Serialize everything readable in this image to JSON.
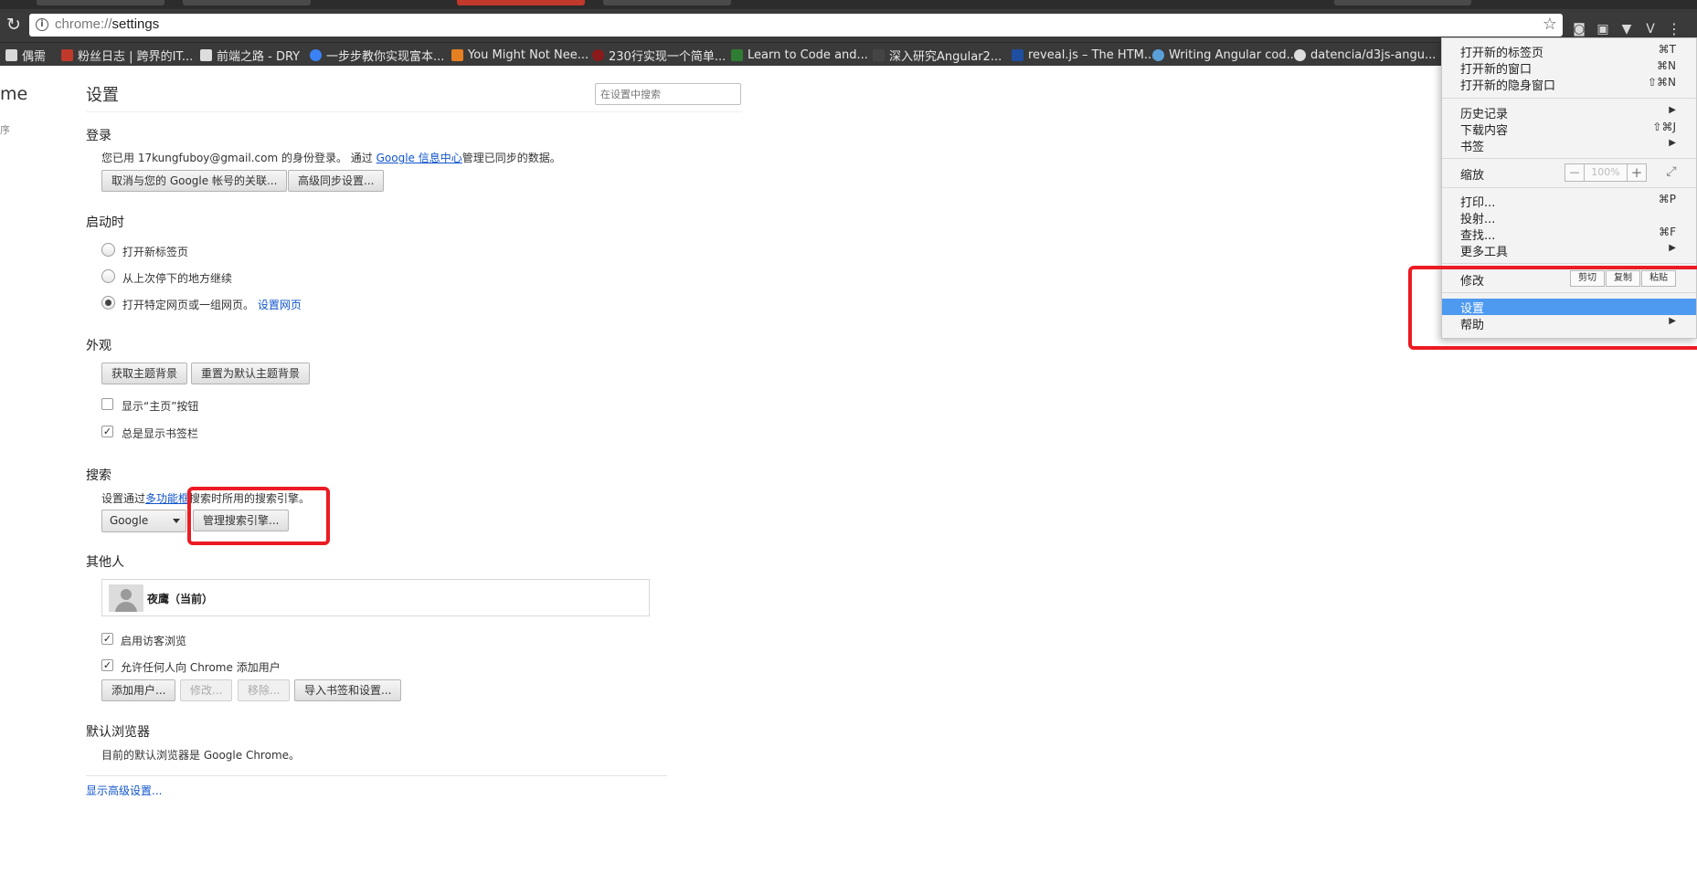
{
  "browser": {
    "url_scheme": "chrome://",
    "url_path": "settings"
  },
  "bookmarks": [
    {
      "label": "偶需",
      "icon": "folder-icon",
      "color": "#d9d9d9"
    },
    {
      "label": "粉丝日志 | 跨界的IT...",
      "icon": "site-icon",
      "color": "#c0392b"
    },
    {
      "label": "前端之路 - DRY",
      "icon": "image-icon",
      "color": "#dddddd"
    },
    {
      "label": "一步步教你实现富本...",
      "icon": "site-icon",
      "color": "#3b82f6"
    },
    {
      "label": "You Might Not Nee...",
      "icon": "site-icon",
      "color": "#e67e22"
    },
    {
      "label": "230行实现一个简单...",
      "icon": "site-icon",
      "color": "#8b1a1a"
    },
    {
      "label": "Learn to Code and...",
      "icon": "site-icon",
      "color": "#2e7d32"
    },
    {
      "label": "深入研究Angular2...",
      "icon": "site-icon",
      "color": "#444444"
    },
    {
      "label": "reveal.js – The HTM...",
      "icon": "site-icon",
      "color": "#1e4fa0"
    },
    {
      "label": "Writing Angular cod...",
      "icon": "cloud-icon",
      "color": "#5aa0d8"
    },
    {
      "label": "datencia/d3js-angu...",
      "icon": "github-icon",
      "color": "#dddddd"
    }
  ],
  "nav": {
    "app_partial": "me",
    "sub_partial": "序"
  },
  "settings": {
    "title": "设置",
    "search_placeholder": "在设置中搜索",
    "signin": {
      "heading": "登录",
      "text_prefix": "您已用 17kungfuboy@gmail.com 的身份登录。 通过 ",
      "link": "Google 信息中心",
      "text_suffix": "管理已同步的数据。",
      "disconnect_button": "取消与您的 Google 帐号的关联...",
      "advanced_sync_button": "高级同步设置..."
    },
    "startup": {
      "heading": "启动时",
      "options": [
        "打开新标签页",
        "从上次停下的地方继续",
        "打开特定网页或一组网页。"
      ],
      "selected_index": 2,
      "set_pages_link": "设置网页"
    },
    "appearance": {
      "heading": "外观",
      "get_themes_button": "获取主题背景",
      "reset_theme_button": "重置为默认主题背景",
      "show_home_label": "显示“主页”按钮",
      "show_home_checked": false,
      "show_bookmarks_label": "总是显示书签栏",
      "show_bookmarks_checked": true
    },
    "search": {
      "heading": "搜索",
      "text_prefix": "设置通过",
      "link": "多功能框",
      "text_suffix": "搜索时所用的搜索引擎。",
      "engine": "Google",
      "manage_button": "管理搜索引擎..."
    },
    "people": {
      "heading": "其他人",
      "profile_name": "夜鹰（当前）",
      "guest_label": "启用访客浏览",
      "guest_checked": true,
      "allow_add_label": "允许任何人向 Chrome 添加用户",
      "allow_add_checked": true,
      "add_user_button": "添加用户...",
      "edit_button": "修改...",
      "remove_button": "移除...",
      "import_button": "导入书签和设置..."
    },
    "default_browser": {
      "heading": "默认浏览器",
      "text": "目前的默认浏览器是 Google Chrome。"
    },
    "show_advanced_link": "显示高级设置..."
  },
  "menu": {
    "new_tab": "打开新的标签页",
    "new_tab_sc": "⌘T",
    "new_window": "打开新的窗口",
    "new_window_sc": "⌘N",
    "incognito": "打开新的隐身窗口",
    "incognito_sc": "⇧⌘N",
    "history": "历史记录",
    "downloads": "下载内容",
    "downloads_sc": "⇧⌘J",
    "bookmarks": "书签",
    "zoom": "缩放",
    "zoom_minus": "—",
    "zoom_value": "100%",
    "zoom_plus": "+",
    "print": "打印...",
    "print_sc": "⌘P",
    "cast": "投射...",
    "find": "查找...",
    "find_sc": "⌘F",
    "more_tools": "更多工具",
    "edit": "修改",
    "cut": "剪切",
    "copy": "复制",
    "paste": "粘贴",
    "settings": "设置",
    "help": "帮助"
  },
  "colors": {
    "link": "#1155cc",
    "menu_highlight": "#4d9af0",
    "annotation_red": "#ec1b23"
  }
}
